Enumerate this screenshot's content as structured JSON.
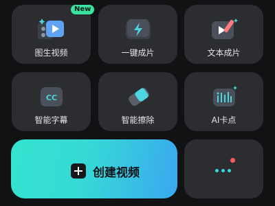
{
  "tiles": [
    {
      "label": "图生视频",
      "icon": "image-to-video-icon"
    },
    {
      "label": "一键成片",
      "icon": "one-click-video-icon"
    },
    {
      "label": "文本成片",
      "icon": "text-to-video-icon"
    },
    {
      "label": "智能字幕",
      "icon": "cc-subtitle-icon"
    },
    {
      "label": "智能擦除",
      "icon": "eraser-icon"
    },
    {
      "label": "AI卡点",
      "icon": "ai-beat-icon"
    }
  ],
  "badge": "New",
  "create_button": {
    "label": "创建视频"
  },
  "colors": {
    "accent_start": "#34e3cf",
    "accent_end": "#3aa8f0",
    "badge": "#39e3a0",
    "tile": "#2b2d31",
    "notification": "#ff5a5a"
  }
}
